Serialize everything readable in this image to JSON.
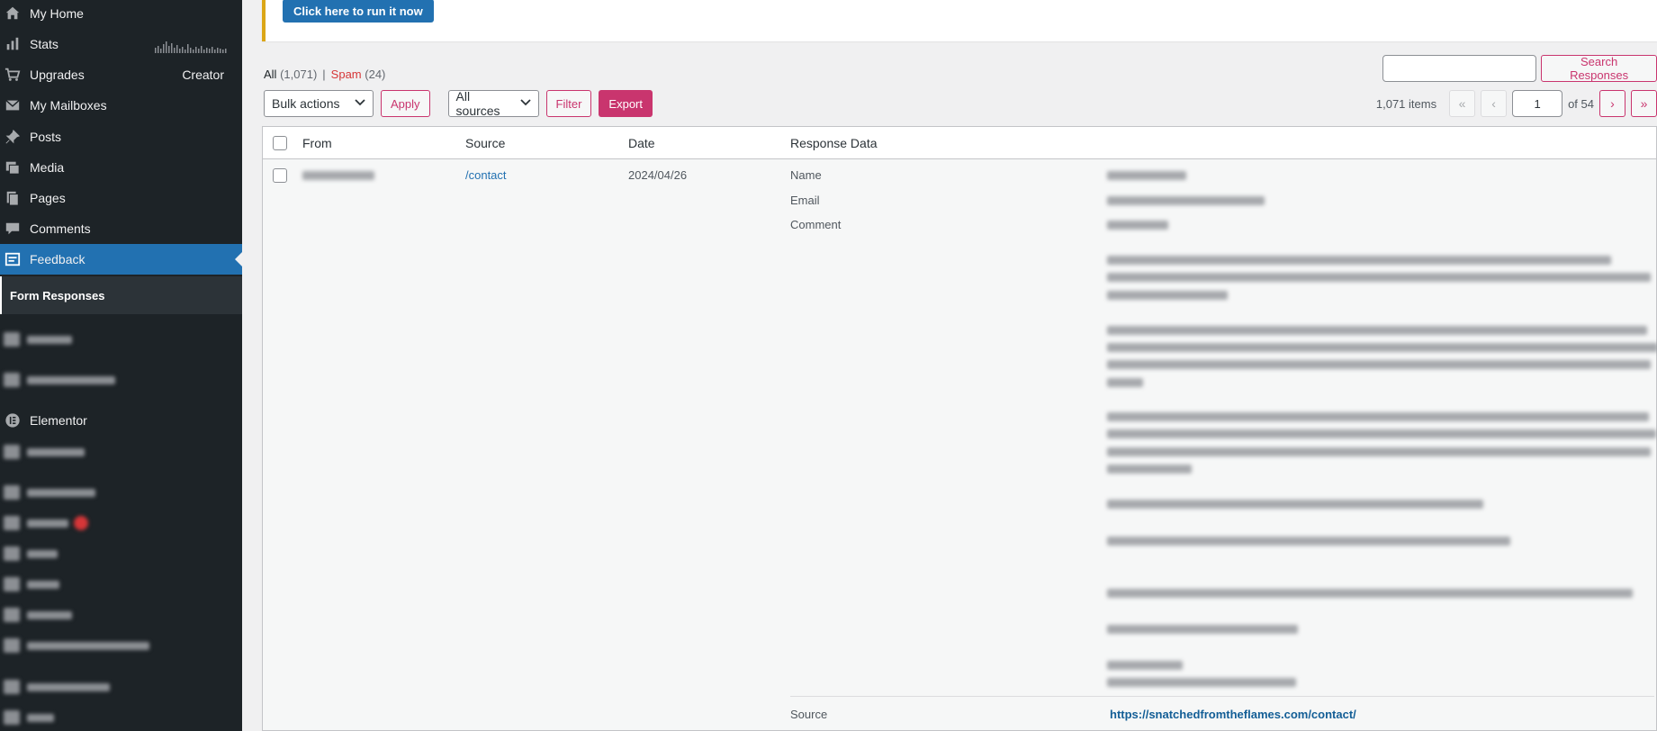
{
  "sidebar": {
    "items": [
      {
        "label": "My Home",
        "icon": "home-icon"
      },
      {
        "label": "Stats",
        "icon": "stats-icon"
      },
      {
        "label": "Upgrades",
        "icon": "cart-icon",
        "extra": "Creator"
      },
      {
        "label": "My Mailboxes",
        "icon": "mail-icon"
      },
      {
        "label": "Posts",
        "icon": "pin-icon"
      },
      {
        "label": "Media",
        "icon": "media-icon"
      },
      {
        "label": "Pages",
        "icon": "pages-icon"
      },
      {
        "label": "Comments",
        "icon": "comment-icon"
      },
      {
        "label": "Feedback",
        "icon": "feedback-icon",
        "active": true
      }
    ],
    "submenu": {
      "label": "Form Responses"
    },
    "elementor": {
      "label": "Elementor",
      "icon": "elementor-icon"
    }
  },
  "notice": {
    "button_label": "Click here to run it now"
  },
  "views": {
    "all_label": "All",
    "all_count": "(1,071)",
    "separator": "|",
    "spam_label": "Spam",
    "spam_count": "(24)"
  },
  "search": {
    "button_label": "Search Responses",
    "value": ""
  },
  "tablenav": {
    "bulk_actions": "Bulk actions",
    "apply": "Apply",
    "sources": "All sources",
    "filter": "Filter",
    "export": "Export"
  },
  "pagination": {
    "items": "1,071 items",
    "first": "«",
    "prev": "‹",
    "current_page": "1",
    "of_label": "of 54",
    "next": "›",
    "last": "»"
  },
  "table": {
    "headers": {
      "from": "From",
      "source": "Source",
      "date": "Date",
      "response": "Response Data"
    },
    "row": {
      "source": "/contact",
      "date": "2024/04/26",
      "fields": {
        "name": "Name",
        "email": "Email",
        "comment": "Comment",
        "source": "Source"
      },
      "source_url": "https://snatchedfromtheflames.com/contact/"
    }
  },
  "colors": {
    "accent": "#c9356e",
    "sidebar_bg": "#1d2327",
    "active_bg": "#2271b1",
    "notice_border": "#dba617"
  }
}
